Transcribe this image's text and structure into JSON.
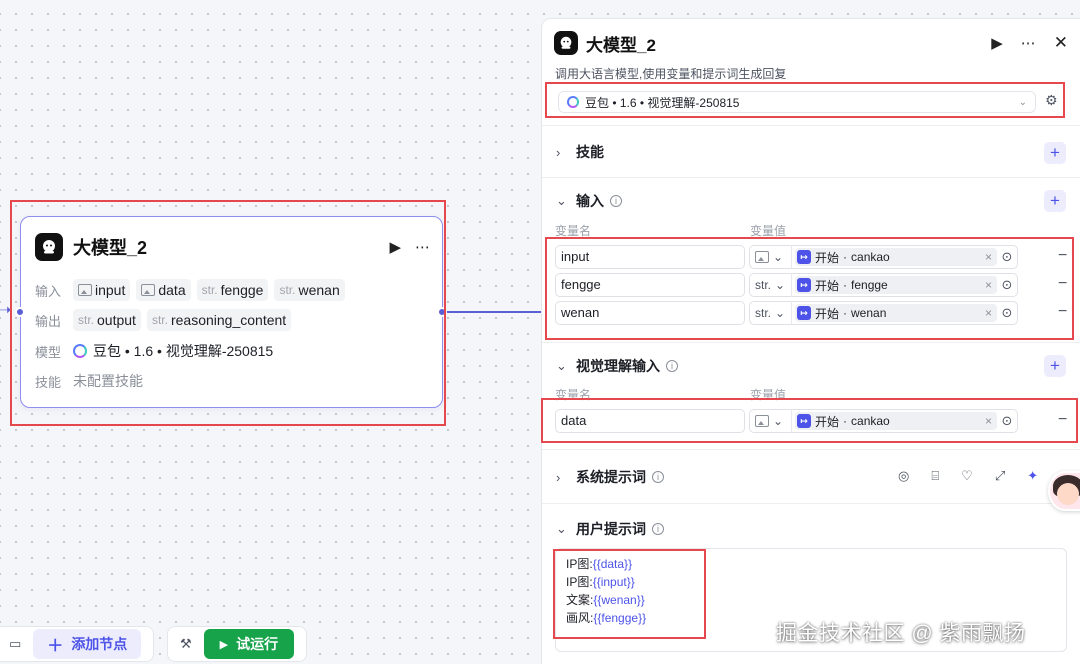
{
  "canvas": {
    "node": {
      "title": "大模型_2",
      "input_label": "输入",
      "inputs": [
        {
          "prefix": "",
          "name": "input"
        },
        {
          "prefix": "",
          "name": "data"
        },
        {
          "prefix": "str.",
          "name": "fengge"
        },
        {
          "prefix": "str.",
          "name": "wenan"
        }
      ],
      "output_label": "输出",
      "outputs": [
        {
          "prefix": "str.",
          "name": "output"
        },
        {
          "prefix": "str.",
          "name": "reasoning_content"
        }
      ],
      "model_label": "模型",
      "model_value": "豆包 • 1.6 • 视觉理解-250815",
      "skills_label": "技能",
      "skills_value": "未配置技能"
    },
    "toolbar": {
      "add_node": "添加节点",
      "run": "试运行"
    }
  },
  "panel": {
    "title": "大模型_2",
    "description": "调用大语言模型,使用变量和提示词生成回复",
    "model": "豆包 • 1.6 • 视觉理解-250815",
    "skills_title": "技能",
    "input_title": "输入",
    "col_name": "变量名",
    "col_value": "变量值",
    "inputs": [
      {
        "name": "input",
        "type": "",
        "ref_node": "开始",
        "ref_var": "cankao"
      },
      {
        "name": "fengge",
        "type": "str.",
        "ref_node": "开始",
        "ref_var": "fengge"
      },
      {
        "name": "wenan",
        "type": "str.",
        "ref_node": "开始",
        "ref_var": "wenan"
      }
    ],
    "vision_title": "视觉理解输入",
    "vision_inputs": [
      {
        "name": "data",
        "type": "",
        "ref_node": "开始",
        "ref_var": "cankao"
      }
    ],
    "system_prompt_title": "系统提示词",
    "user_prompt_title": "用户提示词",
    "user_prompt_lines": [
      {
        "key": "IP图:",
        "var": "{{data}}"
      },
      {
        "key": "IP图:",
        "var": "{{input}}"
      },
      {
        "key": "文案:",
        "var": "{{wenan}}"
      },
      {
        "key": "画风:",
        "var": "{{fengge}}"
      }
    ]
  },
  "watermark": "掘金技术社区 @ 紫雨飘扬",
  "colors": {
    "accent": "#4d53e8",
    "run_green": "#17a34a",
    "highlight_red": "#e5484d",
    "node_border": "#8e8df0"
  }
}
